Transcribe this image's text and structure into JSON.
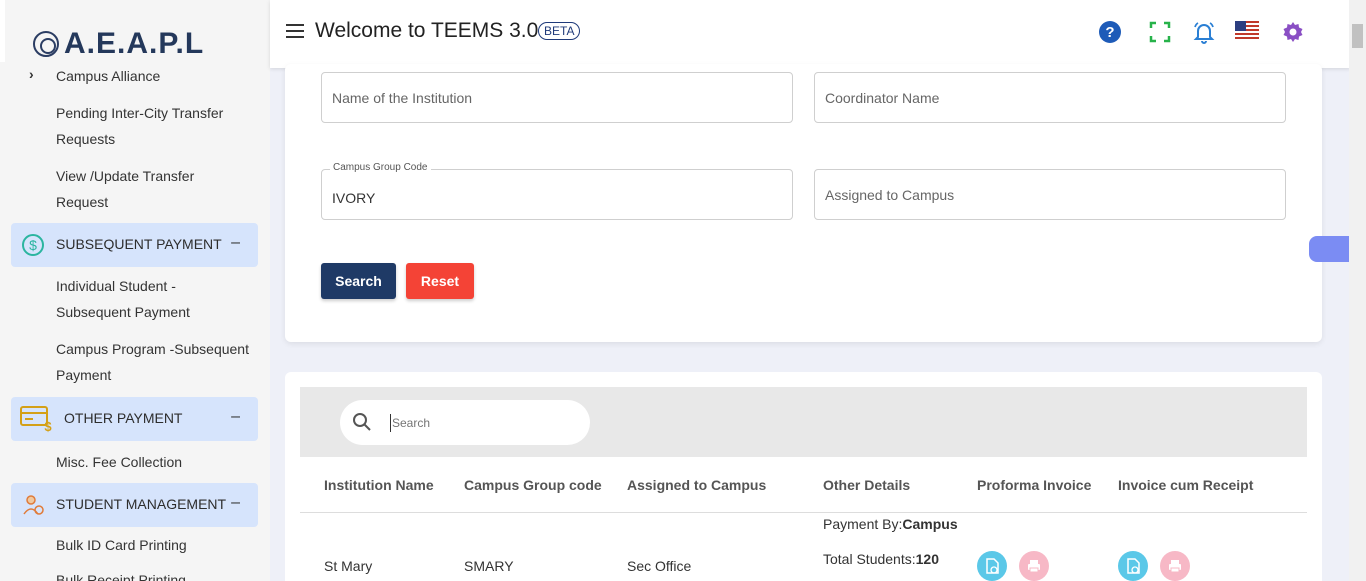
{
  "sidebar": {
    "logo_text": "A.E.A.P.L",
    "items": [
      {
        "label": "Campus Alliance"
      },
      {
        "label": "Pending Inter-City Transfer Requests"
      },
      {
        "label": "View /Update Transfer Request"
      },
      {
        "label": "Individual Student - Subsequent Payment"
      },
      {
        "label": "Campus Program -Subsequent Payment"
      },
      {
        "label": "Misc. Fee Collection"
      },
      {
        "label": "Bulk ID Card Printing"
      },
      {
        "label": "Bulk Receipt Printing"
      }
    ],
    "sections": [
      {
        "label": "SUBSEQUENT PAYMENT",
        "toggle": "–",
        "icon": "dollar-circle-icon",
        "color": "#2bb5a0"
      },
      {
        "label": "OTHER PAYMENT",
        "toggle": "–",
        "icon": "card-payment-icon",
        "color": "#d4a017"
      },
      {
        "label": "STUDENT MANAGEMENT",
        "toggle": "–",
        "icon": "student-icon",
        "color": "#e07b39"
      }
    ]
  },
  "header": {
    "title": "Welcome to TEEMS 3.0",
    "badge": "BETA",
    "icons": [
      "help-icon",
      "fullscreen-icon",
      "notification-bell-icon",
      "us-flag-icon",
      "settings-gear-icon"
    ]
  },
  "form": {
    "institution_placeholder": "Name of the Institution",
    "coordinator_placeholder": "Coordinator Name",
    "campus_group_label": "Campus Group Code",
    "campus_group_value": "IVORY",
    "assigned_placeholder": "Assigned to Campus",
    "search_label": "Search",
    "reset_label": "Reset"
  },
  "colors": {
    "primary": "#1f3a66",
    "danger": "#f44336",
    "sidebar_section": "#d6e4fc",
    "icon_teal": "#5bc8e8",
    "icon_pink": "#f7b8c6"
  },
  "table": {
    "search_placeholder": "Search",
    "columns": [
      "Institution Name",
      "Campus Group code",
      "Assigned to Campus",
      "Other Details",
      "Proforma Invoice",
      "Invoice cum Receipt"
    ],
    "rows": [
      {
        "institution": "St Mary",
        "group_code": "SMARY",
        "assigned": "Sec Office",
        "payment_by_label": "Payment By:",
        "payment_by_value": "Campus",
        "total_students_label": "Total Students:",
        "total_students_value": "120"
      }
    ]
  }
}
